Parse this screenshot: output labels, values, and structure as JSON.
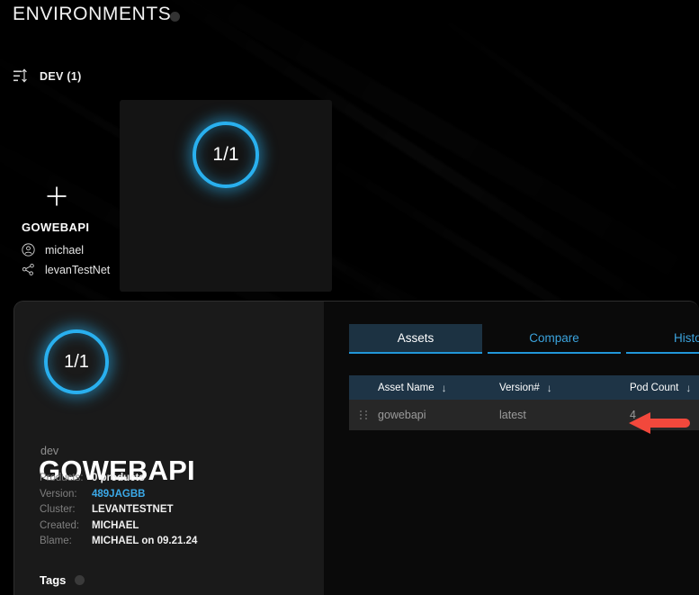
{
  "header": {
    "title": "ENVIRONMENTS",
    "status_dot_color": "#333333"
  },
  "group": {
    "sort_icon": "sort-lines-icon",
    "label": "DEV (1)"
  },
  "add_button": {
    "icon": "plus-icon",
    "label": "+"
  },
  "environment_card": {
    "ring_value": "1/1",
    "name": "GOWEBAPI",
    "owner_icon": "user-icon",
    "owner": "michael",
    "cluster_icon": "network-share-icon",
    "cluster": "levanTestNet"
  },
  "detail": {
    "ring_value": "1/1",
    "subtitle": "dev",
    "name": "GOWEBAPI",
    "fields": [
      {
        "key": "Products:",
        "value": "0 products",
        "link": false
      },
      {
        "key": "Version:",
        "value": "489JAGBB",
        "link": true
      },
      {
        "key": "Cluster:",
        "value": "LEVANTESTNET",
        "link": false
      },
      {
        "key": "Created:",
        "value": "MICHAEL",
        "link": false
      },
      {
        "key": "Blame:",
        "value": "MICHAEL on 09.21.24",
        "link": false
      }
    ],
    "tags_label": "Tags",
    "tags_dot_color": "#3a3a3a"
  },
  "tabs": [
    {
      "label": "Assets",
      "active": true
    },
    {
      "label": "Compare",
      "active": false
    },
    {
      "label": "History",
      "active": false
    }
  ],
  "table": {
    "columns": [
      {
        "label": "Asset Name",
        "sort_icon": "arrow-down-icon"
      },
      {
        "label": "Version#",
        "sort_icon": "arrow-down-icon"
      },
      {
        "label": "Pod Count",
        "sort_icon": "arrow-down-icon"
      }
    ],
    "rows": [
      {
        "handle": "drag-handle-icon",
        "asset_name": "gowebapi",
        "version": "latest",
        "pod_count": "4"
      }
    ]
  },
  "annotation": {
    "arrow_icon": "arrow-left-annotation",
    "color": "#f2483c"
  },
  "colors": {
    "accent_blue": "#29b0ef",
    "link_blue": "#3ba9e8",
    "tab_active_bg": "#1c3242",
    "table_header_bg": "#1e3446",
    "row_bg": "#272727",
    "panel_bg": "#1a1a1a",
    "background": "#000000"
  }
}
